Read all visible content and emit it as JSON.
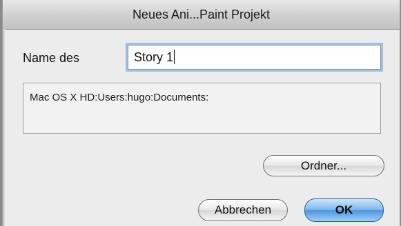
{
  "window": {
    "title": "Neues Ani...Paint Projekt"
  },
  "form": {
    "name_label": "Name des",
    "name_value": "Story 1",
    "path_text": "Mac OS X HD:Users:hugo:Documents:"
  },
  "buttons": {
    "folder": "Ordner...",
    "cancel": "Abbrechen",
    "ok": "OK"
  },
  "colors": {
    "default_button": "#4e95dd",
    "focus_ring": "#9fc0e6",
    "window_bg": "#ececec"
  }
}
